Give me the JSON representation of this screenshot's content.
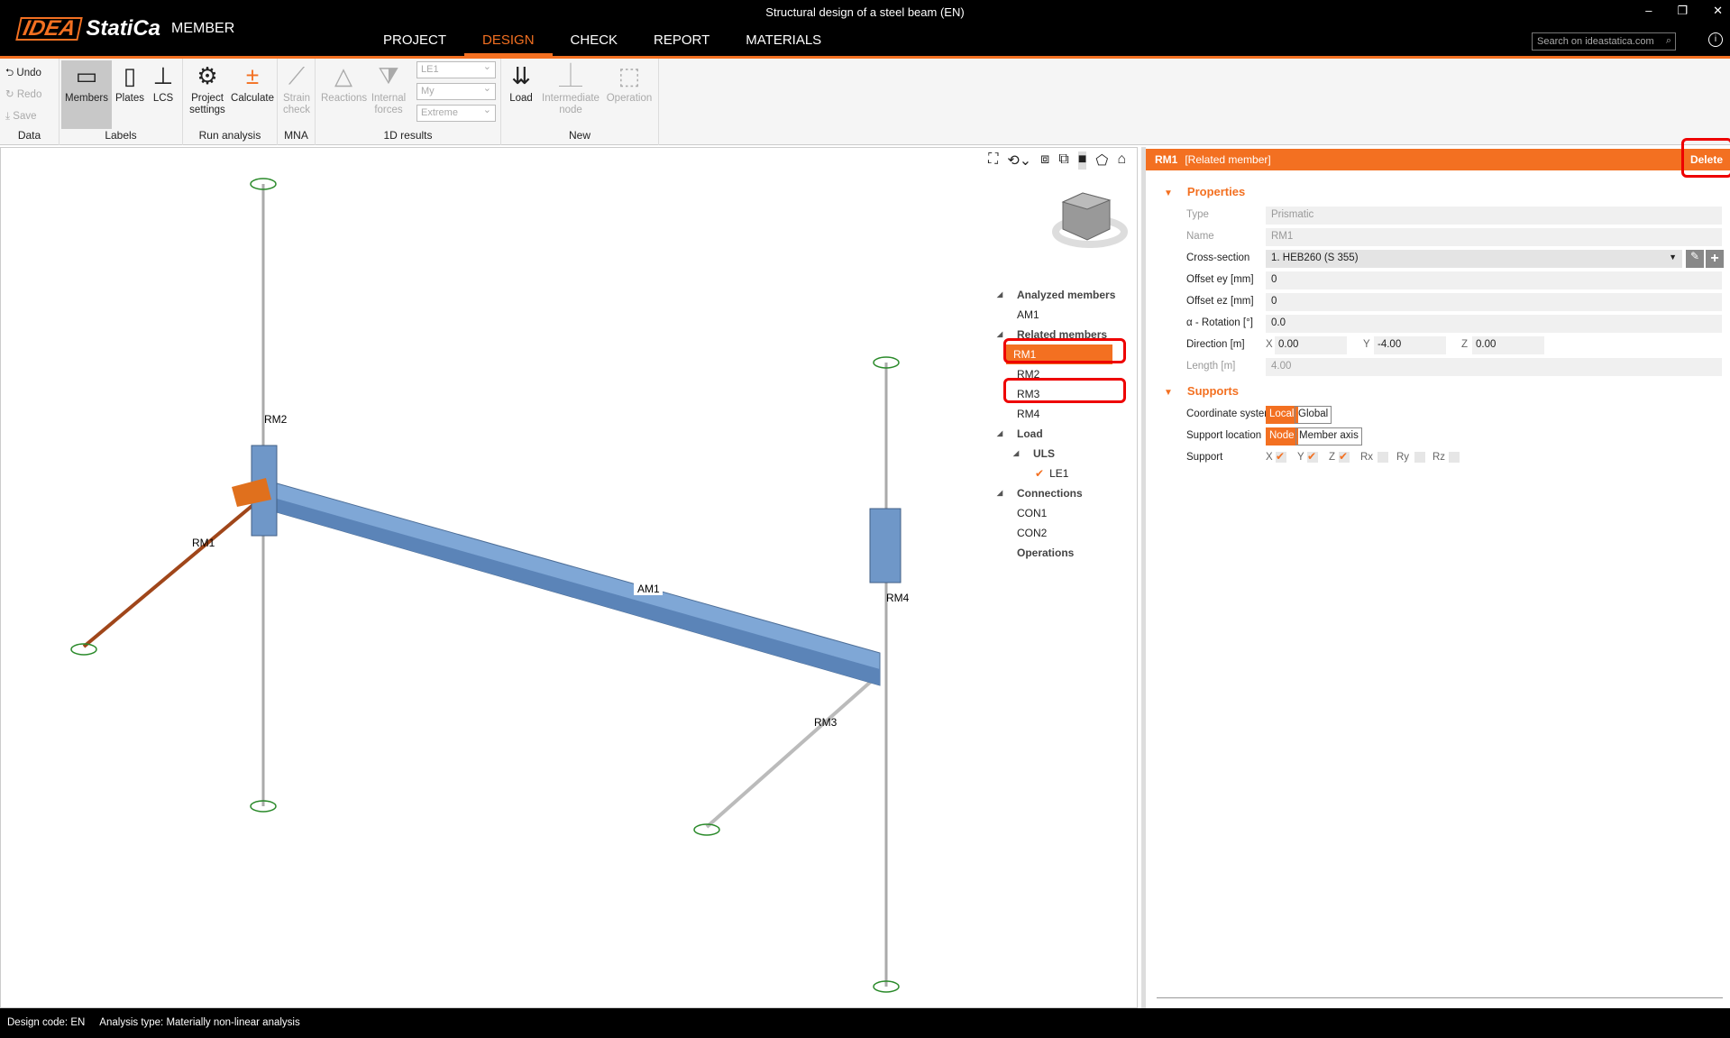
{
  "app": {
    "title": "Structural design of a steel beam (EN)",
    "logo_idea": "IDEA",
    "logo_statica": "StatiCa",
    "product": "MEMBER",
    "search_placeholder": "Search on ideastatica.com"
  },
  "nav": [
    "PROJECT",
    "DESIGN",
    "CHECK",
    "REPORT",
    "MATERIALS"
  ],
  "ribbon": {
    "data": {
      "undo": "Undo",
      "redo": "Redo",
      "save": "Save",
      "label": "Data"
    },
    "labels": {
      "members": "Members",
      "plates": "Plates",
      "lcs": "LCS",
      "label": "Labels"
    },
    "run": {
      "project": "Project settings",
      "calculate": "Calculate",
      "label": "Run analysis"
    },
    "mna": {
      "strain": "Strain check",
      "label": "MNA"
    },
    "results": {
      "reactions": "Reactions",
      "internal": "Internal forces",
      "sel1": "LE1",
      "sel2": "My",
      "sel3": "Extreme",
      "label": "1D results"
    },
    "new": {
      "load": "Load",
      "node": "Intermediate node",
      "operation": "Operation",
      "label": "New"
    }
  },
  "model": {
    "labels": {
      "rm1": "RM1",
      "rm2": "RM2",
      "rm3": "RM3",
      "rm4": "RM4",
      "am1": "AM1"
    }
  },
  "tree": {
    "analyzed": "Analyzed members",
    "am1": "AM1",
    "related": "Related members",
    "rm1": "RM1",
    "rm2": "RM2",
    "rm3": "RM3",
    "rm4": "RM4",
    "load": "Load",
    "uls": "ULS",
    "le1": "LE1",
    "connections": "Connections",
    "con1": "CON1",
    "con2": "CON2",
    "operations": "Operations"
  },
  "panel": {
    "name": "RM1",
    "kind": "[Related member]",
    "delete": "Delete",
    "properties": "Properties",
    "type_label": "Type",
    "type": "Prismatic",
    "name_label": "Name",
    "name_value": "RM1",
    "cs_label": "Cross-section",
    "cs": "1. HEB260 (S 355)",
    "ey_label": "Offset ey [mm]",
    "ey": "0",
    "ez_label": "Offset ez [mm]",
    "ez": "0",
    "rot_label": "α - Rotation [°]",
    "rot": "0.0",
    "dir_label": "Direction [m]",
    "dx": "0.00",
    "dy": "-4.00",
    "dz": "0.00",
    "len_label": "Length [m]",
    "len": "4.00",
    "supports": "Supports",
    "cs_sys_label": "Coordinate system",
    "local": "Local",
    "global": "Global",
    "loc_label": "Support location",
    "node": "Node",
    "axis": "Member axis",
    "support_label": "Support",
    "x": "X",
    "y": "Y",
    "z": "Z",
    "rx": "Rx",
    "ry": "Ry",
    "rz": "Rz"
  },
  "status": {
    "code": "Design code: EN",
    "analysis": "Analysis type: Materially non-linear analysis"
  },
  "colors": {
    "accent": "#f37021",
    "beam": "#7fa7d6",
    "highlight": "#e00000"
  }
}
